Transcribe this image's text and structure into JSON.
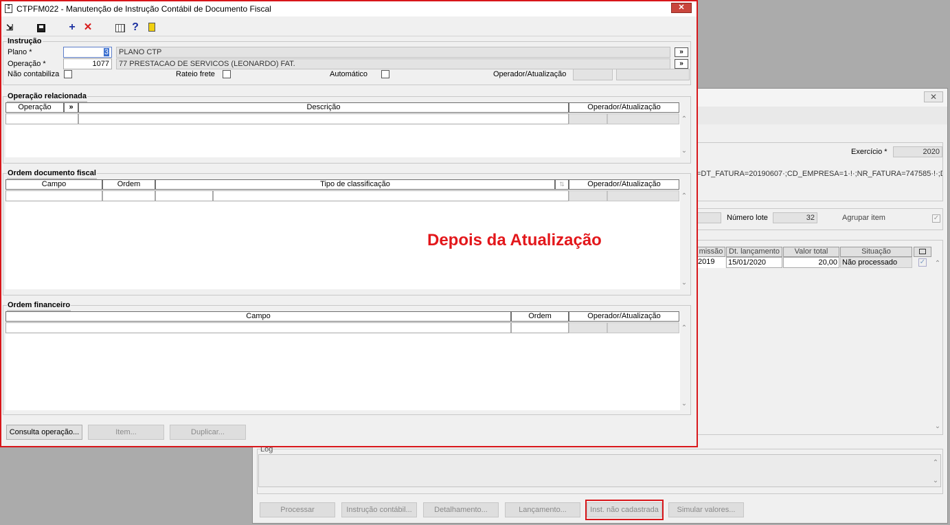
{
  "back_window": {
    "exercicio_label": "Exercício *",
    "exercicio_value": "2020",
    "filter_text": "=DT_FATURA=20190607·;CD_EMPRESA=1·!·;NR_FATURA=747585·!·;DT_FA",
    "numero_lote_label": "Número lote",
    "numero_lote_value": "32",
    "agrupar_item_label": "Agrupar item",
    "grid": {
      "columns": [
        "missão",
        "Dt. lançamento",
        "Valor total",
        "Situação"
      ],
      "row": [
        "2019",
        "15/01/2020",
        "20,00",
        "Não processado"
      ]
    },
    "log_label": "Log",
    "buttons": {
      "processar": "Processar",
      "instrucao": "Instrução contábil...",
      "detalhamento": "Detalhamento...",
      "lancamento": "Lançamento...",
      "inst_nao_cadastrada": "Inst. não cadastrada",
      "simular": "Simular valores..."
    }
  },
  "main_window": {
    "title": "CTPFM022 - Manutenção de Instrução Contábil de Documento Fiscal",
    "instrucao": {
      "group_title": "Instrução",
      "plano_label": "Plano *",
      "plano_value": "3",
      "plano_desc": "PLANO CTP",
      "operacao_label": "Operação *",
      "operacao_value": "1077",
      "operacao_desc": "77 PRESTACAO DE SERVICOS (LEONARDO) FAT.",
      "nao_contabiliza_label": "Não contabiliza",
      "rateio_frete_label": "Rateio frete",
      "automatico_label": "Automático",
      "operador_label": "Operador/Atualização",
      "lookup_glyph": "»"
    },
    "operacao_relacionada": {
      "group_title": "Operação relacionada",
      "columns": [
        "Operação",
        "»",
        "Descrição",
        "Operador/Atualização"
      ]
    },
    "ordem_documento": {
      "group_title": "Ordem documento fiscal",
      "columns": [
        "Campo",
        "Ordem",
        "Tipo de classificação",
        "Operador/Atualização"
      ]
    },
    "ordem_financeiro": {
      "group_title": "Ordem financeiro",
      "columns": [
        "Campo",
        "Ordem",
        "Operador/Atualização"
      ]
    },
    "annotation": "Depois da Atualização",
    "buttons": {
      "consulta": "Consulta operação...",
      "item": "Item...",
      "duplicar": "Duplicar..."
    }
  },
  "colors": {
    "annotation_red": "#e3171b",
    "highlight_red": "#d8161a",
    "panel_bg": "#f0f0f0",
    "desktop_bg": "#ababab"
  }
}
